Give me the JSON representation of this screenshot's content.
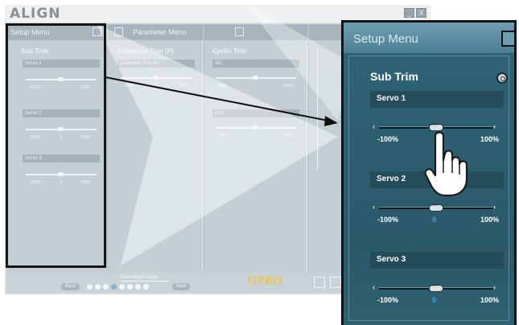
{
  "app": {
    "brand": "ALIGN",
    "window_buttons": [
      "_",
      "X"
    ]
  },
  "background_panels": {
    "setup_menu_header": "Setup Menu",
    "parameter_menu_header": "Parameter Menu",
    "sub_trim_title": "Sub Trim",
    "servos": [
      "Servo 1",
      "Servo 2",
      "Servo 3"
    ],
    "collective_title": "Collective Trim (P)",
    "collective_field": "Collective Trim (P)",
    "cyclic_title": "Cyclic Trim",
    "cyclic_fields": [
      "AIL",
      "ELE"
    ],
    "scale_min": "-100%",
    "scale_mid": "0",
    "scale_max": "100%"
  },
  "footer": {
    "status": "Searching Gauge",
    "back_label": "Back",
    "next_label": "Next",
    "page_dots": 8,
    "active_dot": 4,
    "logo": "GPRO"
  },
  "inset": {
    "header_title": "Setup Menu",
    "section_title": "Sub Trim",
    "servos": [
      {
        "label": "Servo 1",
        "min": "-100%",
        "mid": "",
        "max": "100%",
        "value_pct": 50
      },
      {
        "label": "Servo 2",
        "min": "-100%",
        "mid": "0",
        "max": "100%",
        "value_pct": 50
      },
      {
        "label": "Servo 3",
        "min": "-100%",
        "mid": "0",
        "max": "100%",
        "value_pct": 50
      }
    ]
  },
  "colors": {
    "inset_bg": "#2d5e70",
    "inset_header": "#4c7f94",
    "zero_label": "#3aa0ff",
    "frame": "#151515"
  }
}
